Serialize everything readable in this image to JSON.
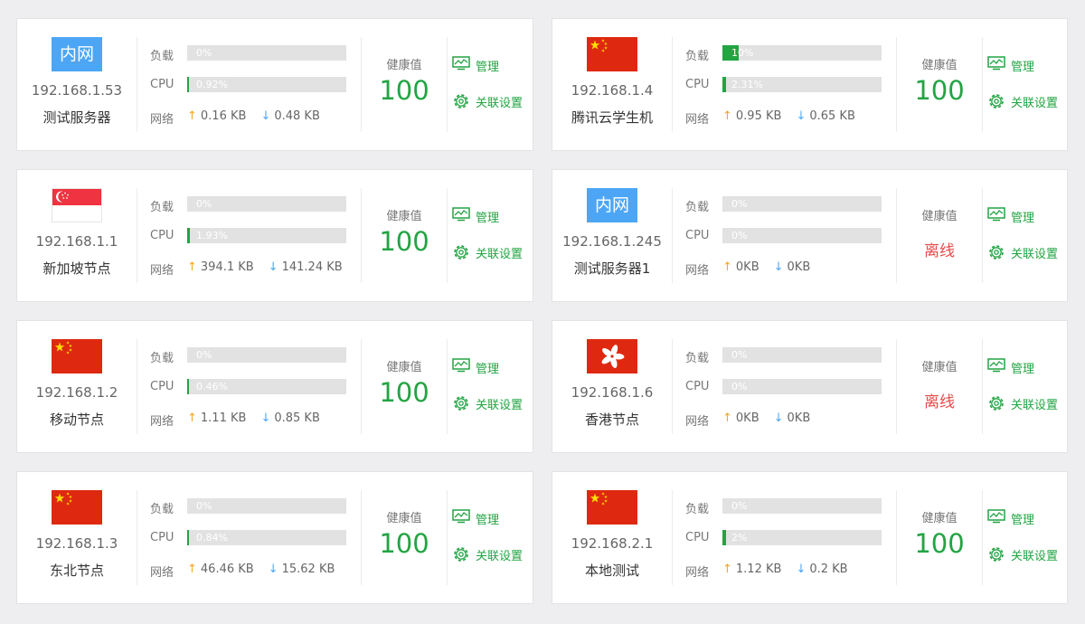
{
  "labels": {
    "load": "负载",
    "cpu": "CPU",
    "network": "网络",
    "health": "健康值",
    "manage": "管理",
    "link_settings": "关联设置",
    "offline": "离线",
    "lan_badge": "内网"
  },
  "colors": {
    "accent_green": "#22a443",
    "offline_red": "#e94a4a",
    "lan_blue": "#4da6f5",
    "up_arrow": "#f5a623",
    "down_arrow": "#4da6f5"
  },
  "servers": [
    {
      "flag": "lan",
      "ip": "192.168.1.53",
      "name": "测试服务器",
      "load": "0%",
      "load_value": 0,
      "cpu": "0.92%",
      "cpu_value": 0.92,
      "up": "0.16 KB",
      "down": "0.48 KB",
      "online": true,
      "health": "100"
    },
    {
      "flag": "cn",
      "ip": "192.168.1.4",
      "name": "腾讯云学生机",
      "load": "10%",
      "load_value": 10,
      "cpu": "2.31%",
      "cpu_value": 2.31,
      "up": "0.95 KB",
      "down": "0.65 KB",
      "online": true,
      "health": "100"
    },
    {
      "flag": "sg",
      "ip": "192.168.1.1",
      "name": "新加坡节点",
      "load": "0%",
      "load_value": 0,
      "cpu": "1.93%",
      "cpu_value": 1.93,
      "up": "394.1 KB",
      "down": "141.24 KB",
      "online": true,
      "health": "100"
    },
    {
      "flag": "lan",
      "ip": "192.168.1.245",
      "name": "测试服务器1",
      "load": "0%",
      "load_value": 0,
      "cpu": "0%",
      "cpu_value": 0,
      "up": "0KB",
      "down": "0KB",
      "online": false,
      "health": ""
    },
    {
      "flag": "cn",
      "ip": "192.168.1.2",
      "name": "移动节点",
      "load": "0%",
      "load_value": 0,
      "cpu": "0.46%",
      "cpu_value": 0.46,
      "up": "1.11 KB",
      "down": "0.85 KB",
      "online": true,
      "health": "100"
    },
    {
      "flag": "hk",
      "ip": "192.168.1.6",
      "name": "香港节点",
      "load": "0%",
      "load_value": 0,
      "cpu": "0%",
      "cpu_value": 0,
      "up": "0KB",
      "down": "0KB",
      "online": false,
      "health": ""
    },
    {
      "flag": "cn",
      "ip": "192.168.1.3",
      "name": "东北节点",
      "load": "0%",
      "load_value": 0,
      "cpu": "0.84%",
      "cpu_value": 0.84,
      "up": "46.46 KB",
      "down": "15.62 KB",
      "online": true,
      "health": "100"
    },
    {
      "flag": "cn",
      "ip": "192.168.2.1",
      "name": "本地测试",
      "load": "0%",
      "load_value": 0,
      "cpu": "2%",
      "cpu_value": 2,
      "up": "1.12 KB",
      "down": "0.2 KB",
      "online": true,
      "health": "100"
    }
  ]
}
